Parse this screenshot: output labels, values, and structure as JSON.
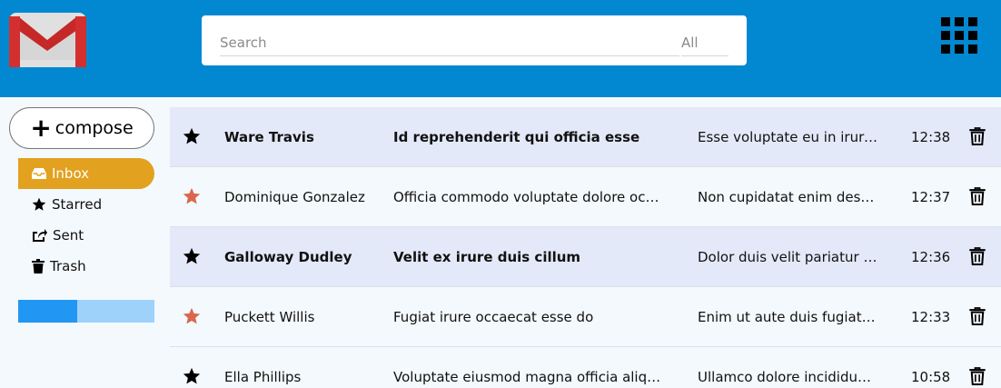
{
  "search": {
    "placeholder": "Search",
    "scope": "All"
  },
  "compose": {
    "label": "compose"
  },
  "sidebar": {
    "items": [
      {
        "label": "Inbox",
        "icon": "inbox-icon",
        "active": true
      },
      {
        "label": "Starred",
        "icon": "star-icon",
        "active": false
      },
      {
        "label": "Sent",
        "icon": "sent-icon",
        "active": false
      },
      {
        "label": "Trash",
        "icon": "trash-icon",
        "active": false
      }
    ],
    "storage_used_fraction": 0.43
  },
  "colors": {
    "topbar": "#0288d1",
    "active_nav": "#e2a11e",
    "starred": "#d9674e",
    "storage_fill": "#2196f3",
    "storage_track": "#9fd2fb"
  },
  "emails": [
    {
      "sender": "Ware Travis",
      "subject": "Id reprehenderit qui officia esse",
      "snippet": "Esse voluptate eu in irure sint",
      "time": "12:38",
      "unread": true,
      "starred": false
    },
    {
      "sender": "Dominique Gonzalez",
      "subject": "Officia commodo voluptate dolore occaecat",
      "snippet": "Non cupidatat enim deserunt",
      "time": "12:37",
      "unread": false,
      "starred": true
    },
    {
      "sender": "Galloway Dudley",
      "subject": "Velit ex irure duis cillum",
      "snippet": "Dolor duis velit pariatur irure",
      "time": "12:36",
      "unread": true,
      "starred": false
    },
    {
      "sender": "Puckett Willis",
      "subject": "Fugiat irure occaecat esse do",
      "snippet": "Enim ut aute duis fugiat labore",
      "time": "12:33",
      "unread": false,
      "starred": true
    },
    {
      "sender": "Ella Phillips",
      "subject": "Voluptate eiusmod magna officia aliquip",
      "snippet": "Ullamco dolore incididunt sint",
      "time": "10:58",
      "unread": false,
      "starred": false
    }
  ]
}
